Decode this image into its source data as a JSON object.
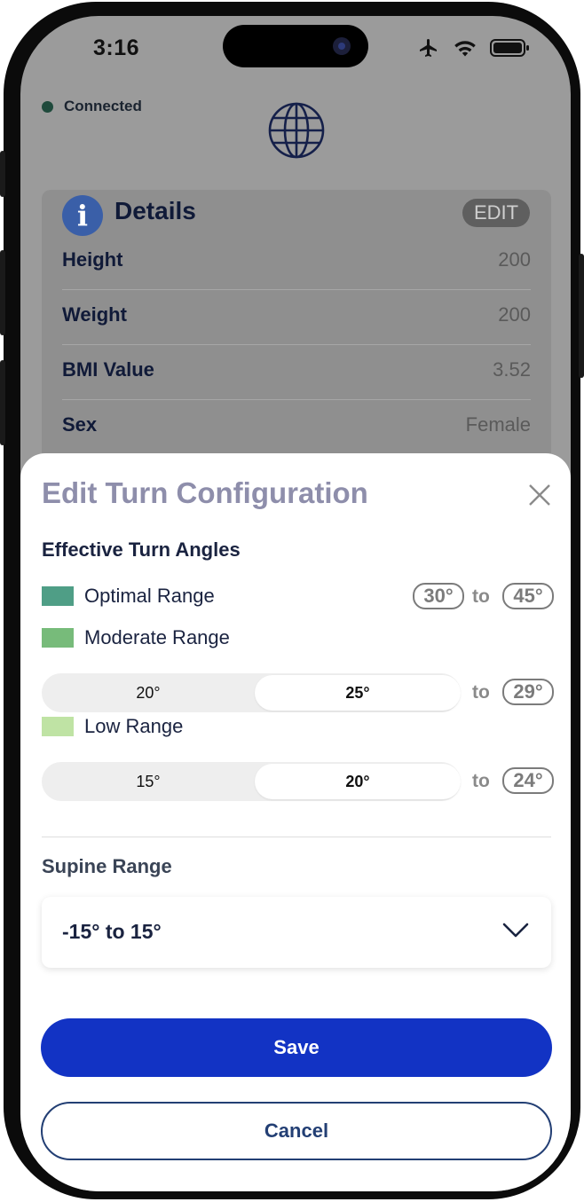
{
  "status_bar": {
    "time": "3:16",
    "icons": [
      "airplane-icon",
      "wifi-icon",
      "battery-icon"
    ]
  },
  "background": {
    "connection": {
      "label": "Connected",
      "dot_color": "#1f4a3c"
    },
    "globe_icon": "globe-icon",
    "details": {
      "title": "Details",
      "edit_label": "EDIT",
      "rows": [
        {
          "label": "Height",
          "value": "200"
        },
        {
          "label": "Weight",
          "value": "200"
        },
        {
          "label": "BMI Value",
          "value": "3.52"
        },
        {
          "label": "Sex",
          "value": "Female"
        }
      ]
    }
  },
  "sheet": {
    "title": "Edit Turn Configuration",
    "close_icon": "close-icon",
    "effective_section": "Effective Turn Angles",
    "ranges": {
      "optimal": {
        "label": "Optimal Range",
        "color": "#4f9e86",
        "from": "30°",
        "to_word": "to",
        "to": "45°"
      },
      "moderate": {
        "label": "Moderate Range",
        "color": "#77bb7a",
        "options": [
          "20°",
          "25°"
        ],
        "selected": "25°",
        "to_word": "to",
        "to": "29°"
      },
      "low": {
        "label": "Low Range",
        "color": "#bfe3a4",
        "options": [
          "15°",
          "20°"
        ],
        "selected": "20°",
        "to_word": "to",
        "to": "24°"
      }
    },
    "supine_section": "Supine Range",
    "supine_value": "-15° to 15°",
    "save_label": "Save",
    "cancel_label": "Cancel",
    "colors": {
      "primary": "#1233c4",
      "cancel_border": "#233f74"
    }
  }
}
